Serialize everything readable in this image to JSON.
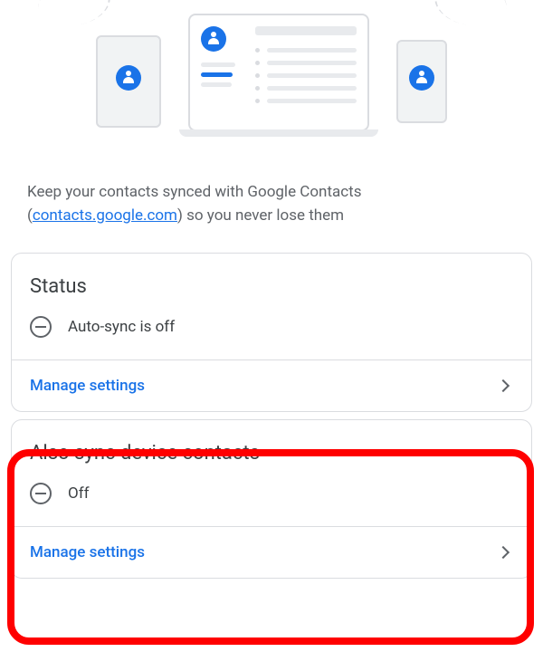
{
  "description": {
    "text_before": "Keep your contacts synced with Google Contacts (",
    "link_text": "contacts.google.com",
    "text_after": ") so you never lose them"
  },
  "card_status": {
    "title": "Status",
    "status_text": "Auto-sync is off",
    "action": "Manage settings"
  },
  "card_device": {
    "title": "Also sync device contacts",
    "status_text": "Off",
    "action": "Manage settings"
  }
}
